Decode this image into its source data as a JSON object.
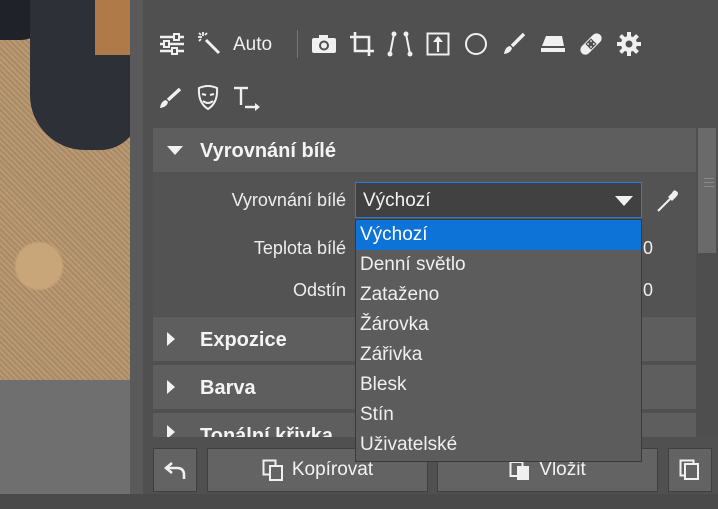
{
  "toolbar": {
    "auto_label": "Auto",
    "icons": [
      "sliders-icon",
      "magic-wand-icon",
      "camera-icon",
      "crop-icon",
      "perspective-icon",
      "export-icon",
      "circle-icon",
      "brush-icon",
      "eraser-icon",
      "bandage-icon",
      "gear-icon",
      "gradient-brush-icon",
      "mask-face-icon",
      "text-icon"
    ]
  },
  "sections": {
    "white_balance": {
      "title": "Vyrovnání bílé",
      "expanded": true
    },
    "exposure": {
      "title": "Expozice"
    },
    "color": {
      "title": "Barva"
    },
    "tone_curve": {
      "title": "Tonální křivka"
    }
  },
  "white_balance": {
    "mode_label": "Vyrovnání bílé",
    "mode_value": "Výchozí",
    "temperature_label": "Teplota bílé",
    "temperature_value": "0",
    "tint_label": "Odstín",
    "tint_value": "0"
  },
  "dropdown": {
    "options": [
      "Výchozí",
      "Denní světlo",
      "Zataženo",
      "Žárovka",
      "Zářivka",
      "Blesk",
      "Stín",
      "Uživatelské"
    ],
    "selected_index": 0
  },
  "bottom": {
    "undo_icon": "undo-icon",
    "copy_label": "Kopírovat",
    "paste_label": "Vložit",
    "duplicate_icon": "copy-stack-icon"
  },
  "colors": {
    "accent": "#0e73d6",
    "panel": "#505050",
    "section": "#5e5e5e"
  }
}
